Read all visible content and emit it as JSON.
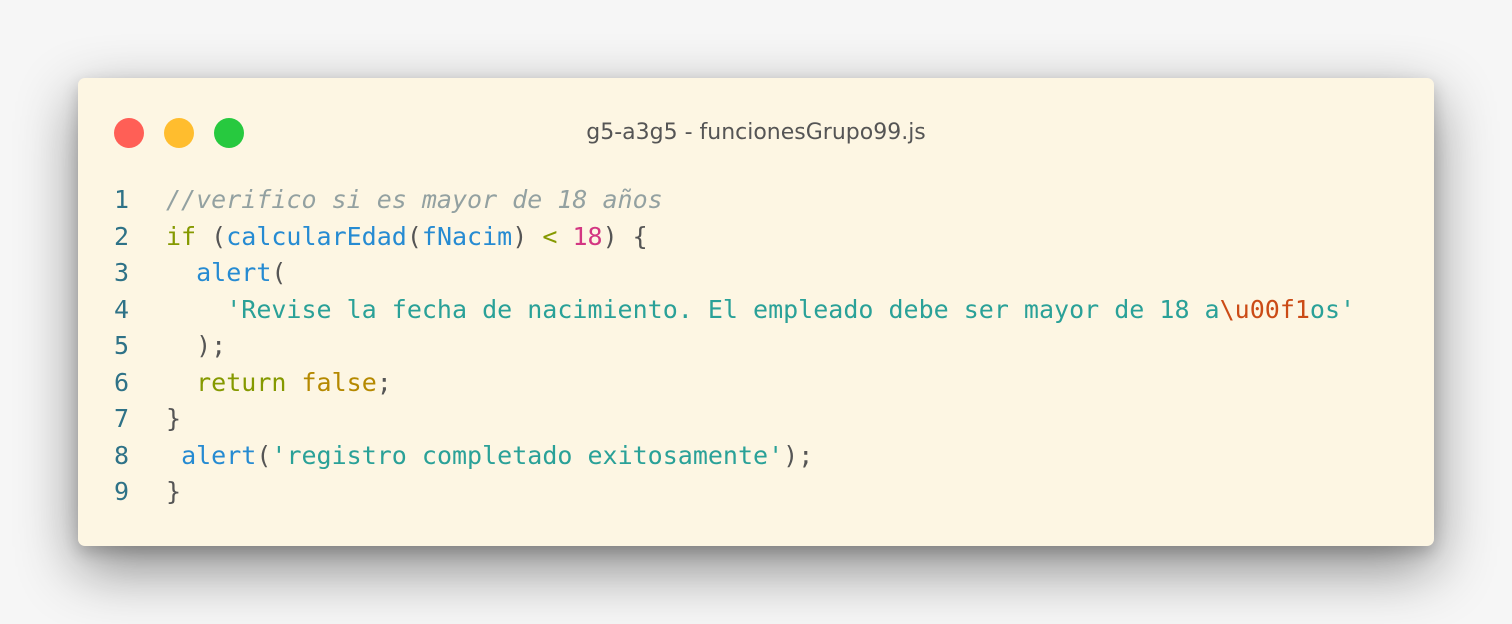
{
  "window": {
    "title": "g5-a3g5 - funcionesGrupo99.js",
    "controls": [
      "close",
      "minimize",
      "maximize"
    ]
  },
  "colors": {
    "background": "#fdf6e3",
    "close": "#ff5f56",
    "minimize": "#ffbd2e",
    "maximize": "#27c93f",
    "line_number": "#2e7287",
    "comment": "#93a1a1",
    "keyword": "#859900",
    "function": "#268bd2",
    "number": "#d33682",
    "string": "#2aa198",
    "escape": "#cb4b16",
    "boolean": "#b58900"
  },
  "code": {
    "lines": [
      {
        "num": "1",
        "tokens": [
          {
            "t": "comment",
            "v": "//verifico si es mayor de 18 años"
          }
        ]
      },
      {
        "num": "2",
        "tokens": [
          {
            "t": "keyword",
            "v": "if"
          },
          {
            "t": "punct",
            "v": " ("
          },
          {
            "t": "func",
            "v": "calcularEdad"
          },
          {
            "t": "punct",
            "v": "("
          },
          {
            "t": "func",
            "v": "fNacim"
          },
          {
            "t": "punct",
            "v": ") "
          },
          {
            "t": "op",
            "v": "<"
          },
          {
            "t": "punct",
            "v": " "
          },
          {
            "t": "number",
            "v": "18"
          },
          {
            "t": "punct",
            "v": ") {"
          }
        ]
      },
      {
        "num": "3",
        "tokens": [
          {
            "t": "punct",
            "v": "  "
          },
          {
            "t": "func",
            "v": "alert"
          },
          {
            "t": "punct",
            "v": "("
          }
        ]
      },
      {
        "num": "4",
        "tokens": [
          {
            "t": "punct",
            "v": "    "
          },
          {
            "t": "string",
            "v": "'Revise la fecha de nacimiento. El empleado debe ser mayor de 18 a"
          },
          {
            "t": "escape",
            "v": "\\u00f1"
          },
          {
            "t": "string",
            "v": "os'"
          }
        ]
      },
      {
        "num": "5",
        "tokens": [
          {
            "t": "punct",
            "v": "  );"
          }
        ]
      },
      {
        "num": "6",
        "tokens": [
          {
            "t": "punct",
            "v": "  "
          },
          {
            "t": "keyword",
            "v": "return"
          },
          {
            "t": "punct",
            "v": " "
          },
          {
            "t": "bool",
            "v": "false"
          },
          {
            "t": "punct",
            "v": ";"
          }
        ]
      },
      {
        "num": "7",
        "tokens": [
          {
            "t": "punct",
            "v": "}"
          }
        ]
      },
      {
        "num": "8",
        "tokens": [
          {
            "t": "punct",
            "v": " "
          },
          {
            "t": "func",
            "v": "alert"
          },
          {
            "t": "punct",
            "v": "("
          },
          {
            "t": "string",
            "v": "'registro completado exitosamente'"
          },
          {
            "t": "punct",
            "v": ");"
          }
        ]
      },
      {
        "num": "9",
        "tokens": [
          {
            "t": "punct",
            "v": "}"
          }
        ]
      }
    ]
  }
}
